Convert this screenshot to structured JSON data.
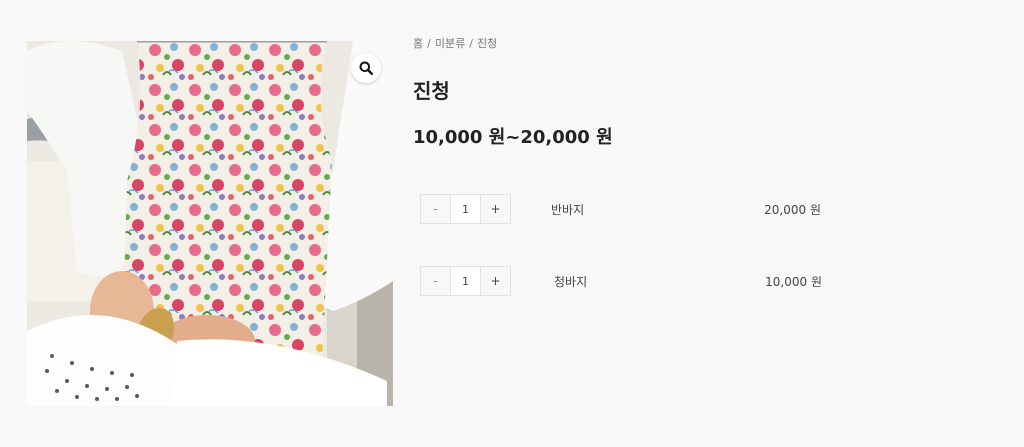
{
  "breadcrumb": {
    "home": "홈",
    "category": "미분류",
    "current": "진청"
  },
  "product": {
    "title": "진청",
    "price_range": "10,000 원~20,000 원",
    "image_alt": "floral apron",
    "zoom_icon": "search-icon"
  },
  "variations": [
    {
      "name": "반바지",
      "price": "20,000 원",
      "quantity": "1",
      "minus_label": "-",
      "plus_label": "+"
    },
    {
      "name": "청바지",
      "price": "10,000 원",
      "quantity": "1",
      "minus_label": "-",
      "plus_label": "+"
    }
  ],
  "colors": {
    "background": "#f8f8f8",
    "minus_accent": "#3ab5a8"
  }
}
